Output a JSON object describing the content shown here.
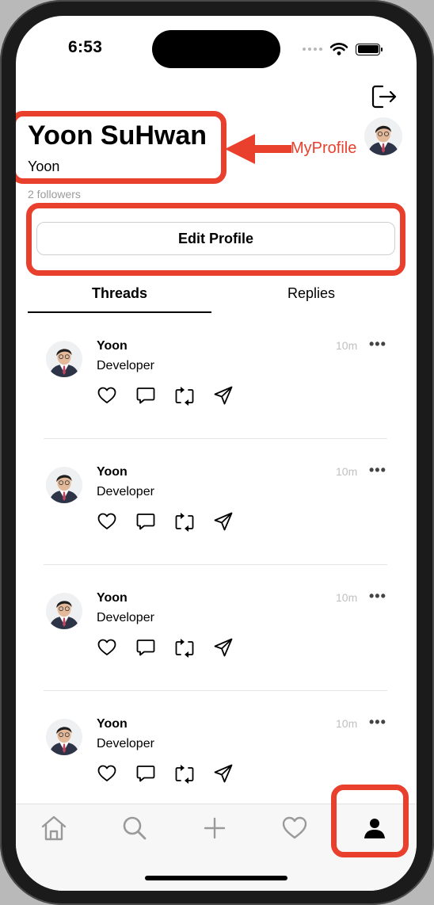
{
  "status_bar": {
    "time": "6:53"
  },
  "profile": {
    "name": "Yoon SuHwan",
    "username": "Yoon",
    "followers": "2 followers",
    "edit_button": "Edit Profile"
  },
  "tabs": [
    {
      "label": "Threads",
      "selected": true
    },
    {
      "label": "Replies",
      "selected": false
    }
  ],
  "threads": [
    {
      "author": "Yoon",
      "content": "Developer",
      "time": "10m",
      "more": "•••"
    },
    {
      "author": "Yoon",
      "content": "Developer",
      "time": "10m",
      "more": "•••"
    },
    {
      "author": "Yoon",
      "content": "Developer",
      "time": "10m",
      "more": "•••"
    },
    {
      "author": "Yoon",
      "content": "Developer",
      "time": "10m",
      "more": "•••"
    }
  ],
  "thread_actions": [
    "heart-icon",
    "comment-icon",
    "repost-icon",
    "share-icon"
  ],
  "tab_bar": [
    "home-icon",
    "search-icon",
    "plus-icon",
    "heart-icon",
    "person-icon"
  ],
  "annotation": {
    "label": "MyProfile",
    "color": "#e8402d"
  }
}
